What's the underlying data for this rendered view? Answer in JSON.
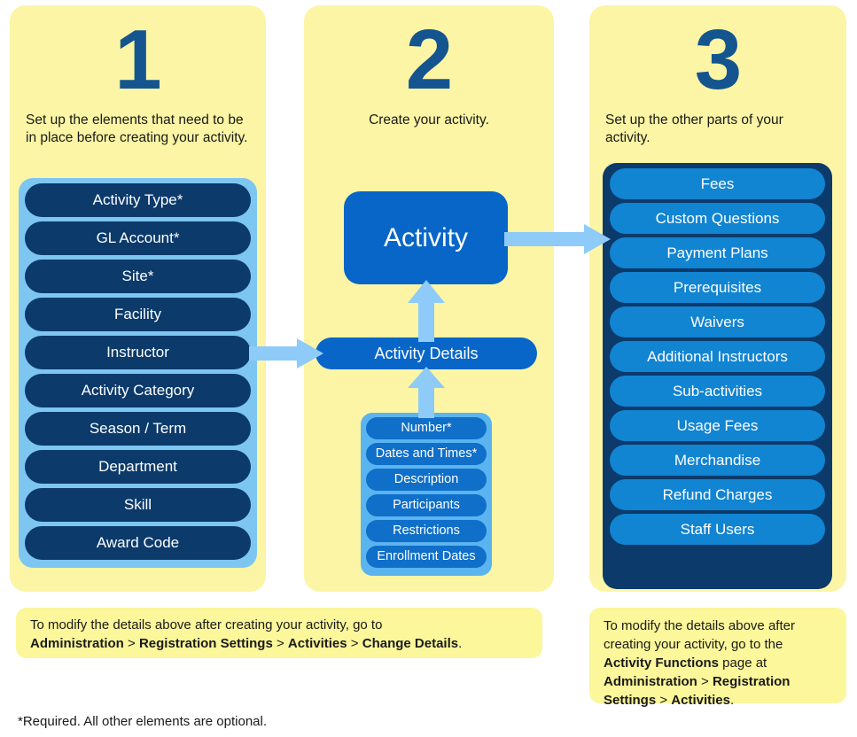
{
  "diagram": {
    "title": "Activity Setup Three-Step Flow",
    "colors": {
      "panel_yellow": "#fbf5a5",
      "note_yellow": "#fbf79a",
      "navy": "#0b3a6b",
      "mid_blue": "#0766c8",
      "bright_blue": "#1184d2",
      "light_blue": "#7ec6f2",
      "arrow_blue": "#8ecbf8",
      "number_blue": "#14558f"
    }
  },
  "steps": [
    {
      "number": "1",
      "description": "Set up the elements that need to be in place before creating your activity.",
      "items": [
        "Activity Type*",
        "GL Account*",
        "Site*",
        "Facility",
        "Instructor",
        "Activity Category",
        "Season / Term",
        "Department",
        "Skill",
        "Award Code"
      ]
    },
    {
      "number": "2",
      "description": "Create your activity.",
      "activity_label": "Activity",
      "details_label": "Activity Details",
      "items": [
        "Number*",
        "Dates and Times*",
        "Description",
        "Participants",
        "Restrictions",
        "Enrollment Dates"
      ]
    },
    {
      "number": "3",
      "description": "Set up the other parts of your activity.",
      "items": [
        "Fees",
        "Custom Questions",
        "Payment Plans",
        "Prerequisites",
        "Waivers",
        "Additional Instructors",
        "Sub-activities",
        "Usage Fees",
        "Merchandise",
        "Refund Charges",
        "Staff Users"
      ]
    }
  ],
  "notes": {
    "left": {
      "line1": "To modify the details above after creating your activity, go to",
      "bold1": "Administration",
      "sep1": " > ",
      "bold2": "Registration Settings",
      "sep2": " > ",
      "bold3": "Activities",
      "sep3": " > ",
      "bold4": "Change Details",
      "end": "."
    },
    "right": {
      "line1": "To modify the details above after creating your activity, go to the ",
      "bold1": "Activity Functions",
      "mid1": " page at ",
      "bold2": "Administration",
      "sep1": " > ",
      "bold3": "Registration Settings",
      "sep2": " > ",
      "bold4": "Activities",
      "end": "."
    }
  },
  "footnote": "*Required. All other elements are optional.",
  "icons": {
    "arrow_right_1": "arrow-right-icon",
    "arrow_right_2": "arrow-right-icon",
    "arrow_up_1": "arrow-up-icon",
    "arrow_up_2": "arrow-up-icon"
  }
}
